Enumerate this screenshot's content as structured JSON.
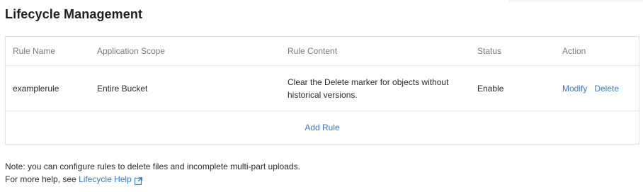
{
  "page": {
    "title": "Lifecycle Management"
  },
  "table": {
    "headers": {
      "rule_name": "Rule Name",
      "application_scope": "Application Scope",
      "rule_content": "Rule Content",
      "status": "Status",
      "action": "Action"
    },
    "rows": [
      {
        "rule_name": "examplerule",
        "application_scope": "Entire Bucket",
        "rule_content": "Clear the Delete marker for objects without historical versions.",
        "status": "Enable",
        "actions": {
          "modify": "Modify",
          "delete": "Delete"
        }
      }
    ],
    "add_rule_label": "Add Rule"
  },
  "notes": {
    "line1": "Note: you can configure rules to delete files and incomplete multi-part uploads.",
    "help_prefix": "For more help, see",
    "help_link": "Lifecycle Help",
    "help_icon": "external-link-icon"
  },
  "colors": {
    "link": "#3d77c7",
    "border": "#dcdfe6",
    "header_text": "#777b82"
  }
}
